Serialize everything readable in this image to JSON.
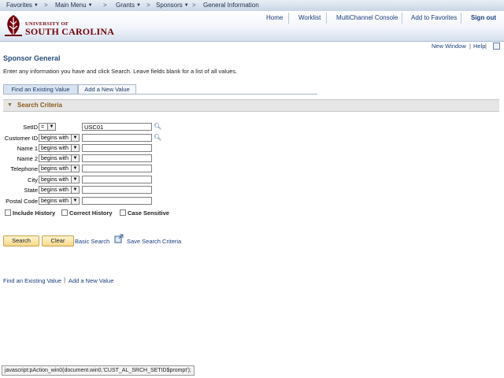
{
  "topnav": {
    "favorites": "Favorites",
    "main_menu": "Main Menu",
    "grants": "Grants",
    "sponsors": "Sponsors",
    "general_information": "General Information",
    "sep": ">"
  },
  "header": {
    "logo_line1": "UNIVERSITY OF",
    "logo_line2": "SOUTH CAROLINA",
    "links": {
      "home": "Home",
      "worklist": "Worklist",
      "multichannel": "MultiChannel Console",
      "add_favorites": "Add to Favorites",
      "sign_out": "Sign out"
    }
  },
  "utility": {
    "new_window": "New Window",
    "divider": "|",
    "help": "Help"
  },
  "page": {
    "title": "Sponsor General",
    "instructions": "Enter any information you have and click Search. Leave fields blank for a list of all values."
  },
  "tabs": {
    "existing": "Find an Existing Value",
    "new": "Add a New Value"
  },
  "criteria": {
    "header": "Search Criteria",
    "fields": [
      {
        "label": "SetID",
        "operator": "=",
        "value": "USC01"
      },
      {
        "label": "Customer ID",
        "operator": "begins with",
        "value": ""
      },
      {
        "label": "Name 1",
        "operator": "begins with",
        "value": ""
      },
      {
        "label": "Name 2",
        "operator": "begins with",
        "value": ""
      },
      {
        "label": "Telephone",
        "operator": "begins with",
        "value": ""
      },
      {
        "label": "City",
        "operator": "begins with",
        "value": ""
      },
      {
        "label": "State",
        "operator": "begins with",
        "value": ""
      },
      {
        "label": "Postal Code",
        "operator": "begins with",
        "value": ""
      }
    ],
    "checkboxes": {
      "include_history": "Include History",
      "correct_history": "Correct History",
      "case_sensitive": "Case Sensitive"
    }
  },
  "actions": {
    "search": "Search",
    "clear": "Clear",
    "basic_search": "Basic Search",
    "save_criteria": "Save Search Criteria"
  },
  "footer": {
    "find_existing": "Find an Existing Value",
    "divider": "|",
    "add_new": "Add a New Value"
  },
  "status_bar": "javascript:pAction_win0(document.win0,'CUST_AL_SRCH_SETID$prompt');"
}
